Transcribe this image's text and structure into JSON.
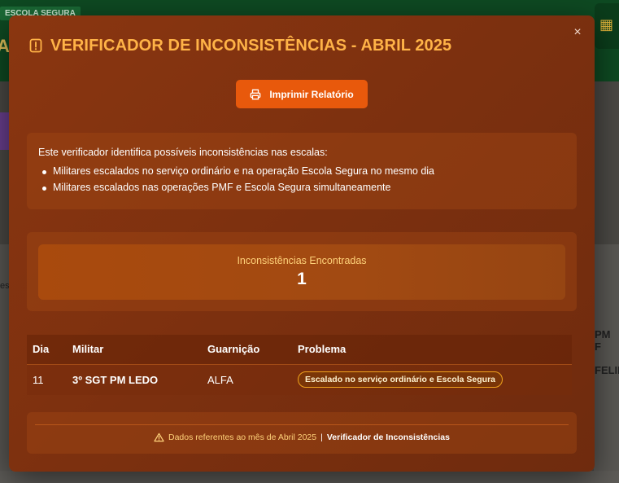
{
  "background": {
    "tag": "ESCOLA SEGURA",
    "header_letter": "A",
    "right_text_1": "PM F",
    "right_text_2": "FELIP",
    "left_text_1": "es"
  },
  "modal": {
    "title": "VERIFICADOR DE INCONSISTÊNCIAS - ABRIL 2025",
    "title_icon": "alert-square-icon",
    "close_label": "×",
    "print_button": {
      "label": "Imprimir Relatório",
      "icon": "printer-icon"
    },
    "info": {
      "intro": "Este verificador identifica possíveis inconsistências nas escalas:",
      "items": [
        "Militares escalados no serviço ordinário e na operação Escola Segura no mesmo dia",
        "Militares escalados nas operações PMF e Escola Segura simultaneamente"
      ]
    },
    "summary": {
      "label": "Inconsistências Encontradas",
      "value": "1"
    },
    "table": {
      "headers": [
        "Dia",
        "Militar",
        "Guarnição",
        "Problema"
      ],
      "rows": [
        {
          "dia": "11",
          "militar": "3º SGT PM LEDO",
          "guarnicao": "ALFA",
          "problema": "Escalado no serviço ordinário e Escola Segura"
        }
      ]
    },
    "footer": {
      "icon": "warning-triangle-icon",
      "text": "Dados referentes ao mês de Abril 2025",
      "separator": "|",
      "strong": "Verificador de Inconsistências"
    }
  },
  "colors": {
    "title": "#ffb347",
    "accent_button": "#e8590c",
    "badge_border": "#f0a21d"
  }
}
